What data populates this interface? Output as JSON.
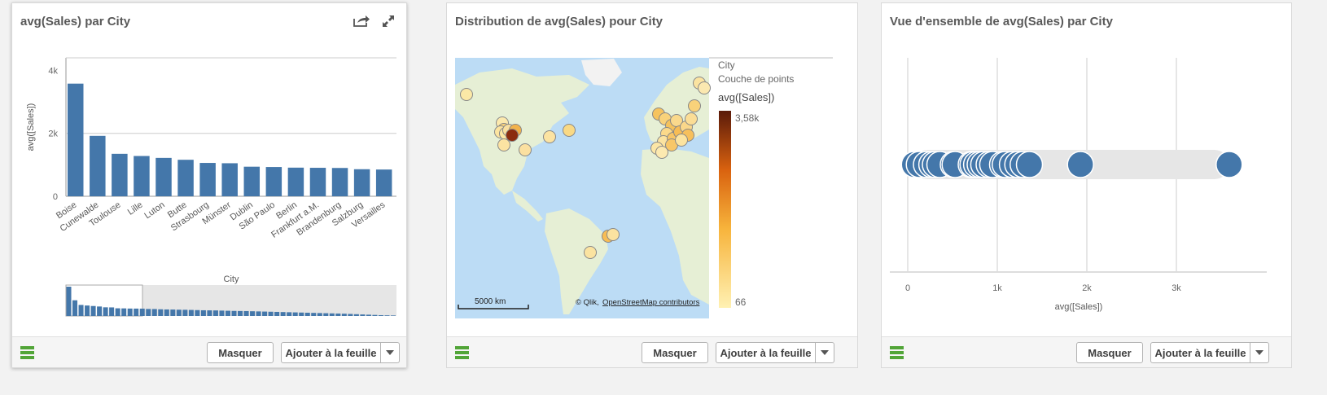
{
  "cards": [
    {
      "title": "avg(Sales) par City",
      "hide_label": "Masquer",
      "add_label": "Ajouter à la feuille",
      "icons": [
        "share-icon",
        "expand-icon",
        "menu-icon",
        "chevron-down-icon"
      ]
    },
    {
      "title": "Distribution de avg(Sales) pour City",
      "hide_label": "Masquer",
      "add_label": "Ajouter à la feuille",
      "icons": [
        "menu-icon",
        "chevron-down-icon"
      ]
    },
    {
      "title": "Vue d'ensemble de avg(Sales) par City",
      "hide_label": "Masquer",
      "add_label": "Ajouter à la feuille",
      "icons": [
        "menu-icon",
        "chevron-down-icon"
      ]
    }
  ],
  "chart_data": [
    {
      "type": "bar",
      "ylabel": "avg([Sales])",
      "xlabel": "City",
      "yticks": [
        "0",
        "2k",
        "4k"
      ],
      "ylim": [
        0,
        4400
      ],
      "categories": [
        "Boise",
        "Cunewalde",
        "Toulouse",
        "Lille",
        "Luton",
        "Butte",
        "Strasbourg",
        "Münster",
        "Dublin",
        "São Paulo",
        "Berlin",
        "Frankfurt a.M.",
        "Brandenburg",
        "Salzburg",
        "Versailles"
      ],
      "values": [
        3580,
        1920,
        1350,
        1280,
        1220,
        1160,
        1060,
        1050,
        940,
        930,
        910,
        905,
        900,
        860,
        850
      ],
      "color": "#4477aa",
      "minimap_values": [
        3580,
        1920,
        1350,
        1280,
        1220,
        1160,
        1060,
        1050,
        940,
        930,
        910,
        905,
        900,
        860,
        850,
        820,
        800,
        790,
        770,
        760,
        740,
        720,
        700,
        690,
        680,
        660,
        640,
        620,
        610,
        600,
        580,
        560,
        540,
        520,
        500,
        480,
        460,
        440,
        420,
        400,
        380,
        360,
        340,
        320,
        300,
        280,
        250,
        220,
        190,
        160,
        130,
        100,
        80,
        66
      ]
    },
    {
      "type": "map",
      "legend_field": "City",
      "legend_layer": "Couche de points",
      "legend_measure": "avg([Sales])",
      "legend_max": "3,58k",
      "legend_min": "66",
      "scale_label": "5000 km",
      "attribution_prefix": "© Qlik,",
      "attribution_link": "OpenStreetMap contributors",
      "colors": {
        "low": "#fff1b3",
        "mid": "#f5a623",
        "high": "#5a1a0a",
        "water": "#bcdcf5",
        "land": "#e6efd5"
      }
    },
    {
      "type": "scatter",
      "xlabel": "avg([Sales])",
      "xticks": [
        "0",
        "1k",
        "2k",
        "3k"
      ],
      "xlim": [
        0,
        3800
      ],
      "values": [
        66,
        120,
        200,
        260,
        300,
        350,
        500,
        520,
        700,
        720,
        760,
        800,
        840,
        900,
        940,
        1050,
        1080,
        1160,
        1220,
        1280,
        1350,
        1920,
        3580
      ],
      "color": "#4477aa"
    }
  ]
}
